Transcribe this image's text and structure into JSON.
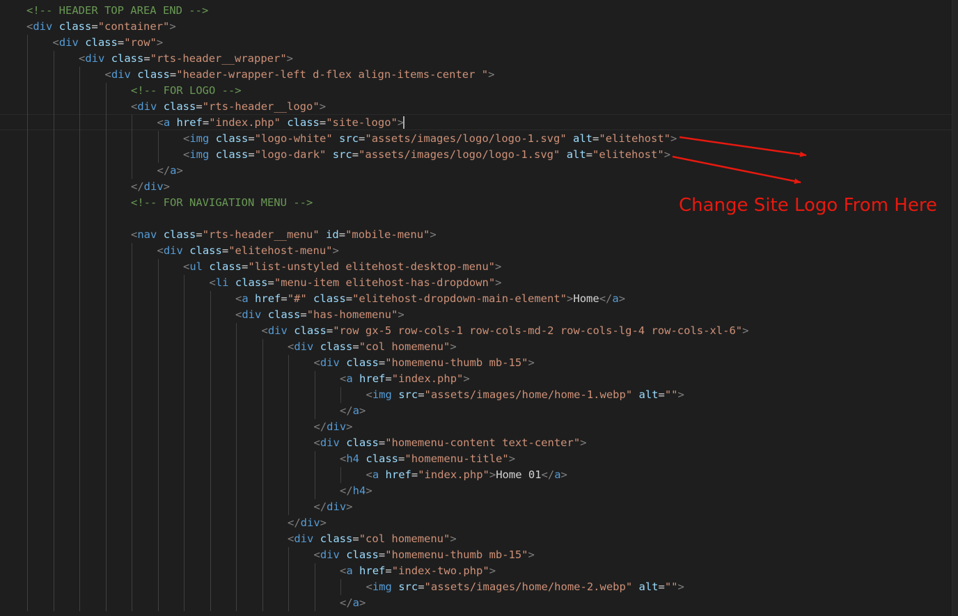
{
  "editor": {
    "lines": [
      [
        [
          "cm",
          "<!-- HEADER TOP AREA END -->"
        ]
      ],
      [
        [
          "pn",
          "<"
        ],
        [
          "tg",
          "div"
        ],
        [
          "tx",
          " "
        ],
        [
          "at",
          "class"
        ],
        [
          "eq",
          "="
        ],
        [
          "st",
          "\"container\""
        ],
        [
          "pn",
          ">"
        ]
      ],
      [
        [
          "pn",
          "<"
        ],
        [
          "tg",
          "div"
        ],
        [
          "tx",
          " "
        ],
        [
          "at",
          "class"
        ],
        [
          "eq",
          "="
        ],
        [
          "st",
          "\"row\""
        ],
        [
          "pn",
          ">"
        ]
      ],
      [
        [
          "pn",
          "<"
        ],
        [
          "tg",
          "div"
        ],
        [
          "tx",
          " "
        ],
        [
          "at",
          "class"
        ],
        [
          "eq",
          "="
        ],
        [
          "st",
          "\"rts-header__wrapper\""
        ],
        [
          "pn",
          ">"
        ]
      ],
      [
        [
          "pn",
          "<"
        ],
        [
          "tg",
          "div"
        ],
        [
          "tx",
          " "
        ],
        [
          "at",
          "class"
        ],
        [
          "eq",
          "="
        ],
        [
          "st",
          "\"header-wrapper-left d-flex align-items-center \""
        ],
        [
          "pn",
          ">"
        ]
      ],
      [
        [
          "cm",
          "<!-- FOR LOGO -->"
        ]
      ],
      [
        [
          "pn",
          "<"
        ],
        [
          "tg",
          "div"
        ],
        [
          "tx",
          " "
        ],
        [
          "at",
          "class"
        ],
        [
          "eq",
          "="
        ],
        [
          "st",
          "\"rts-header__logo\""
        ],
        [
          "pn",
          ">"
        ]
      ],
      [
        [
          "pn",
          "<"
        ],
        [
          "tg",
          "a"
        ],
        [
          "tx",
          " "
        ],
        [
          "at",
          "href"
        ],
        [
          "eq",
          "="
        ],
        [
          "st",
          "\"index.php\""
        ],
        [
          "tx",
          " "
        ],
        [
          "at",
          "class"
        ],
        [
          "eq",
          "="
        ],
        [
          "st",
          "\"site-logo\""
        ],
        [
          "pn",
          ">"
        ]
      ],
      [
        [
          "pn",
          "<"
        ],
        [
          "tg",
          "img"
        ],
        [
          "tx",
          " "
        ],
        [
          "at",
          "class"
        ],
        [
          "eq",
          "="
        ],
        [
          "st",
          "\"logo-white\""
        ],
        [
          "tx",
          " "
        ],
        [
          "at",
          "src"
        ],
        [
          "eq",
          "="
        ],
        [
          "st",
          "\"assets/images/logo/logo-1.svg\""
        ],
        [
          "tx",
          " "
        ],
        [
          "at",
          "alt"
        ],
        [
          "eq",
          "="
        ],
        [
          "st",
          "\"elitehost\""
        ],
        [
          "pn",
          ">"
        ]
      ],
      [
        [
          "pn",
          "<"
        ],
        [
          "tg",
          "img"
        ],
        [
          "tx",
          " "
        ],
        [
          "at",
          "class"
        ],
        [
          "eq",
          "="
        ],
        [
          "st",
          "\"logo-dark\""
        ],
        [
          "tx",
          " "
        ],
        [
          "at",
          "src"
        ],
        [
          "eq",
          "="
        ],
        [
          "st",
          "\"assets/images/logo/logo-1.svg\""
        ],
        [
          "tx",
          " "
        ],
        [
          "at",
          "alt"
        ],
        [
          "eq",
          "="
        ],
        [
          "st",
          "\"elitehost\""
        ],
        [
          "pn",
          ">"
        ]
      ],
      [
        [
          "pn",
          "</"
        ],
        [
          "tg",
          "a"
        ],
        [
          "pn",
          ">"
        ]
      ],
      [
        [
          "pn",
          "</"
        ],
        [
          "tg",
          "div"
        ],
        [
          "pn",
          ">"
        ]
      ],
      [
        [
          "cm",
          "<!-- FOR NAVIGATION MENU -->"
        ]
      ],
      [],
      [
        [
          "pn",
          "<"
        ],
        [
          "tg",
          "nav"
        ],
        [
          "tx",
          " "
        ],
        [
          "at",
          "class"
        ],
        [
          "eq",
          "="
        ],
        [
          "st",
          "\"rts-header__menu\""
        ],
        [
          "tx",
          " "
        ],
        [
          "at",
          "id"
        ],
        [
          "eq",
          "="
        ],
        [
          "st",
          "\"mobile-menu\""
        ],
        [
          "pn",
          ">"
        ]
      ],
      [
        [
          "pn",
          "<"
        ],
        [
          "tg",
          "div"
        ],
        [
          "tx",
          " "
        ],
        [
          "at",
          "class"
        ],
        [
          "eq",
          "="
        ],
        [
          "st",
          "\"elitehost-menu\""
        ],
        [
          "pn",
          ">"
        ]
      ],
      [
        [
          "pn",
          "<"
        ],
        [
          "tg",
          "ul"
        ],
        [
          "tx",
          " "
        ],
        [
          "at",
          "class"
        ],
        [
          "eq",
          "="
        ],
        [
          "st",
          "\"list-unstyled elitehost-desktop-menu\""
        ],
        [
          "pn",
          ">"
        ]
      ],
      [
        [
          "pn",
          "<"
        ],
        [
          "tg",
          "li"
        ],
        [
          "tx",
          " "
        ],
        [
          "at",
          "class"
        ],
        [
          "eq",
          "="
        ],
        [
          "st",
          "\"menu-item elitehost-has-dropdown\""
        ],
        [
          "pn",
          ">"
        ]
      ],
      [
        [
          "pn",
          "<"
        ],
        [
          "tg",
          "a"
        ],
        [
          "tx",
          " "
        ],
        [
          "at",
          "href"
        ],
        [
          "eq",
          "="
        ],
        [
          "st",
          "\"#\""
        ],
        [
          "tx",
          " "
        ],
        [
          "at",
          "class"
        ],
        [
          "eq",
          "="
        ],
        [
          "st",
          "\"elitehost-dropdown-main-element\""
        ],
        [
          "pn",
          ">"
        ],
        [
          "tx",
          "Home"
        ],
        [
          "pn",
          "</"
        ],
        [
          "tg",
          "a"
        ],
        [
          "pn",
          ">"
        ]
      ],
      [
        [
          "pn",
          "<"
        ],
        [
          "tg",
          "div"
        ],
        [
          "tx",
          " "
        ],
        [
          "at",
          "class"
        ],
        [
          "eq",
          "="
        ],
        [
          "st",
          "\"has-homemenu\""
        ],
        [
          "pn",
          ">"
        ]
      ],
      [
        [
          "pn",
          "<"
        ],
        [
          "tg",
          "div"
        ],
        [
          "tx",
          " "
        ],
        [
          "at",
          "class"
        ],
        [
          "eq",
          "="
        ],
        [
          "st",
          "\"row gx-5 row-cols-1 row-cols-md-2 row-cols-lg-4 row-cols-xl-6\""
        ],
        [
          "pn",
          ">"
        ]
      ],
      [
        [
          "pn",
          "<"
        ],
        [
          "tg",
          "div"
        ],
        [
          "tx",
          " "
        ],
        [
          "at",
          "class"
        ],
        [
          "eq",
          "="
        ],
        [
          "st",
          "\"col homemenu\""
        ],
        [
          "pn",
          ">"
        ]
      ],
      [
        [
          "pn",
          "<"
        ],
        [
          "tg",
          "div"
        ],
        [
          "tx",
          " "
        ],
        [
          "at",
          "class"
        ],
        [
          "eq",
          "="
        ],
        [
          "st",
          "\"homemenu-thumb mb-15\""
        ],
        [
          "pn",
          ">"
        ]
      ],
      [
        [
          "pn",
          "<"
        ],
        [
          "tg",
          "a"
        ],
        [
          "tx",
          " "
        ],
        [
          "at",
          "href"
        ],
        [
          "eq",
          "="
        ],
        [
          "st",
          "\"index.php\""
        ],
        [
          "pn",
          ">"
        ]
      ],
      [
        [
          "pn",
          "<"
        ],
        [
          "tg",
          "img"
        ],
        [
          "tx",
          " "
        ],
        [
          "at",
          "src"
        ],
        [
          "eq",
          "="
        ],
        [
          "st",
          "\"assets/images/home/home-1.webp\""
        ],
        [
          "tx",
          " "
        ],
        [
          "at",
          "alt"
        ],
        [
          "eq",
          "="
        ],
        [
          "st",
          "\"\""
        ],
        [
          "pn",
          ">"
        ]
      ],
      [
        [
          "pn",
          "</"
        ],
        [
          "tg",
          "a"
        ],
        [
          "pn",
          ">"
        ]
      ],
      [
        [
          "pn",
          "</"
        ],
        [
          "tg",
          "div"
        ],
        [
          "pn",
          ">"
        ]
      ],
      [
        [
          "pn",
          "<"
        ],
        [
          "tg",
          "div"
        ],
        [
          "tx",
          " "
        ],
        [
          "at",
          "class"
        ],
        [
          "eq",
          "="
        ],
        [
          "st",
          "\"homemenu-content text-center\""
        ],
        [
          "pn",
          ">"
        ]
      ],
      [
        [
          "pn",
          "<"
        ],
        [
          "tg",
          "h4"
        ],
        [
          "tx",
          " "
        ],
        [
          "at",
          "class"
        ],
        [
          "eq",
          "="
        ],
        [
          "st",
          "\"homemenu-title\""
        ],
        [
          "pn",
          ">"
        ]
      ],
      [
        [
          "pn",
          "<"
        ],
        [
          "tg",
          "a"
        ],
        [
          "tx",
          " "
        ],
        [
          "at",
          "href"
        ],
        [
          "eq",
          "="
        ],
        [
          "st",
          "\"index.php\""
        ],
        [
          "pn",
          ">"
        ],
        [
          "tx",
          "Home 01"
        ],
        [
          "pn",
          "</"
        ],
        [
          "tg",
          "a"
        ],
        [
          "pn",
          ">"
        ]
      ],
      [
        [
          "pn",
          "</"
        ],
        [
          "tg",
          "h4"
        ],
        [
          "pn",
          ">"
        ]
      ],
      [
        [
          "pn",
          "</"
        ],
        [
          "tg",
          "div"
        ],
        [
          "pn",
          ">"
        ]
      ],
      [
        [
          "pn",
          "</"
        ],
        [
          "tg",
          "div"
        ],
        [
          "pn",
          ">"
        ]
      ],
      [
        [
          "pn",
          "<"
        ],
        [
          "tg",
          "div"
        ],
        [
          "tx",
          " "
        ],
        [
          "at",
          "class"
        ],
        [
          "eq",
          "="
        ],
        [
          "st",
          "\"col homemenu\""
        ],
        [
          "pn",
          ">"
        ]
      ],
      [
        [
          "pn",
          "<"
        ],
        [
          "tg",
          "div"
        ],
        [
          "tx",
          " "
        ],
        [
          "at",
          "class"
        ],
        [
          "eq",
          "="
        ],
        [
          "st",
          "\"homemenu-thumb mb-15\""
        ],
        [
          "pn",
          ">"
        ]
      ],
      [
        [
          "pn",
          "<"
        ],
        [
          "tg",
          "a"
        ],
        [
          "tx",
          " "
        ],
        [
          "at",
          "href"
        ],
        [
          "eq",
          "="
        ],
        [
          "st",
          "\"index-two.php\""
        ],
        [
          "pn",
          ">"
        ]
      ],
      [
        [
          "pn",
          "<"
        ],
        [
          "tg",
          "img"
        ],
        [
          "tx",
          " "
        ],
        [
          "at",
          "src"
        ],
        [
          "eq",
          "="
        ],
        [
          "st",
          "\"assets/images/home/home-2.webp\""
        ],
        [
          "tx",
          " "
        ],
        [
          "at",
          "alt"
        ],
        [
          "eq",
          "="
        ],
        [
          "st",
          "\"\""
        ],
        [
          "pn",
          ">"
        ]
      ],
      [
        [
          "pn",
          "</"
        ],
        [
          "tg",
          "a"
        ],
        [
          "pn",
          ">"
        ]
      ]
    ]
  },
  "annotation": {
    "text": "Change Site Logo From Here",
    "color": "#e8190f"
  },
  "colors": {
    "background": "#1e1e1e",
    "comment": "#6a9955",
    "tag": "#569cd6",
    "punctuation": "#808080",
    "attribute": "#9cdcfe",
    "string": "#ce9178",
    "text": "#d4d4d4"
  }
}
